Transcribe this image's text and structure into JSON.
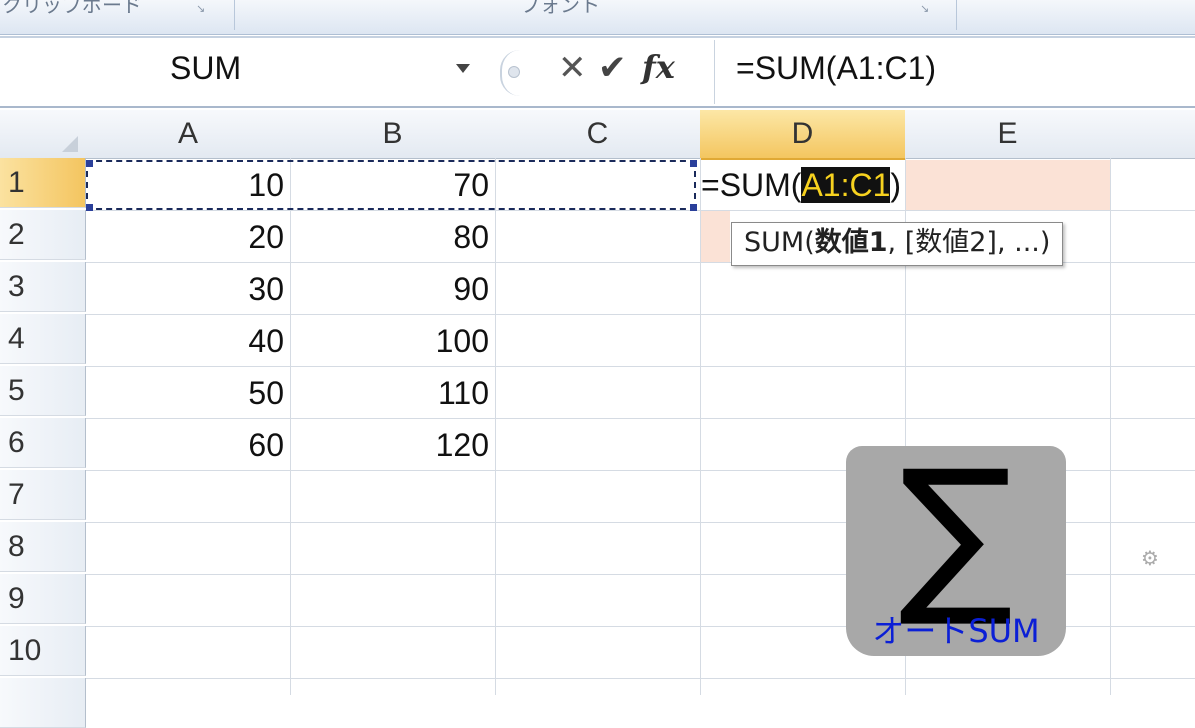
{
  "ribbon": {
    "groups": [
      {
        "label": "クリップボード"
      },
      {
        "label": "フォント"
      }
    ]
  },
  "formula_bar": {
    "name_box": "SUM",
    "cancel_glyph": "✕",
    "enter_glyph": "✔",
    "fx_glyph": "fx",
    "formula": "=SUM(A1:C1)"
  },
  "columns": [
    "A",
    "B",
    "C",
    "D",
    "E"
  ],
  "active_column": "D",
  "rows": [
    "1",
    "2",
    "3",
    "4",
    "5",
    "6",
    "7",
    "8",
    "9",
    "10"
  ],
  "active_row": "1",
  "cells": {
    "A": [
      "10",
      "20",
      "30",
      "40",
      "50",
      "60"
    ],
    "B": [
      "70",
      "80",
      "90",
      "100",
      "110",
      "120"
    ]
  },
  "edit_cell": {
    "prefix": "=SUM(",
    "reference": "A1:C1",
    "suffix": ")"
  },
  "tooltip": {
    "func": "SUM(",
    "arg1": "数値1",
    "rest": ", [数値2], ...)"
  },
  "badge": {
    "symbol": "∑",
    "caption": "オートSUM"
  },
  "colors": {
    "active_header": "#f4c660",
    "reference_highlight": "#f7d21f",
    "badge_caption": "#0b1fd6"
  }
}
